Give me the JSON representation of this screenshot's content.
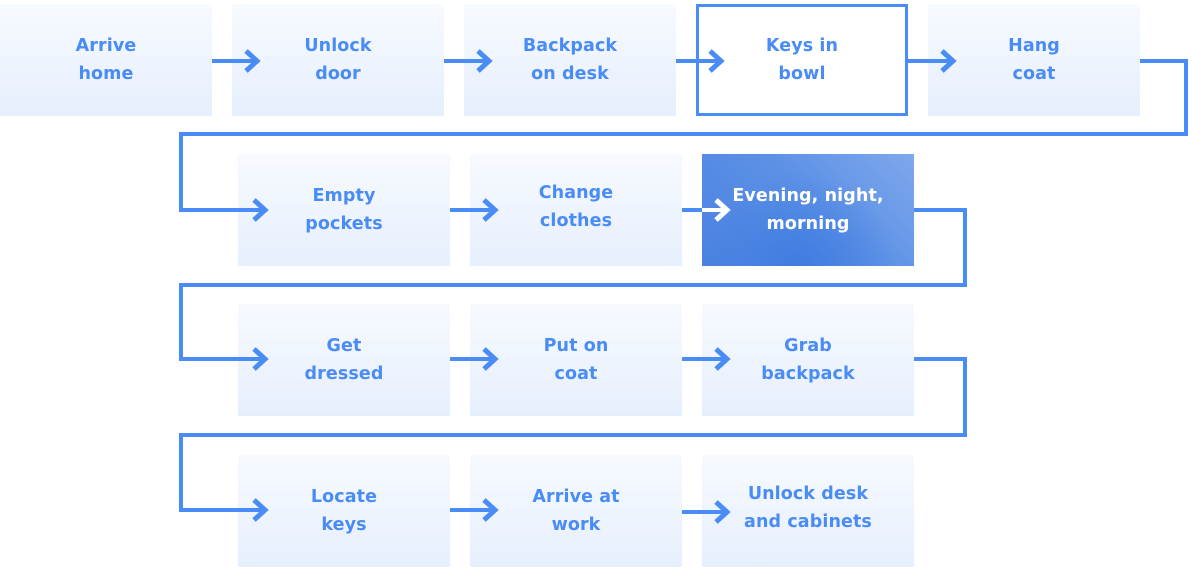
{
  "diagram": {
    "type": "process-flow",
    "colors": {
      "accent": "#4a8cf5",
      "box_fill_top": "#f7faff",
      "box_fill_bottom": "#e6effd",
      "highlight_fill": "#5d91e6",
      "highlight_text": "#ffffff"
    },
    "steps": [
      {
        "id": "arrive-home",
        "label": "Arrive\nhome",
        "style": "normal"
      },
      {
        "id": "unlock-door",
        "label": "Unlock\ndoor",
        "style": "normal"
      },
      {
        "id": "backpack-on-desk",
        "label": "Backpack\non desk",
        "style": "normal"
      },
      {
        "id": "keys-in-bowl",
        "label": "Keys in\nbowl",
        "style": "outlined"
      },
      {
        "id": "hang-coat",
        "label": "Hang\ncoat",
        "style": "normal"
      },
      {
        "id": "empty-pockets",
        "label": "Empty\npockets",
        "style": "normal"
      },
      {
        "id": "change-clothes",
        "label": "Change\nclothes",
        "style": "normal"
      },
      {
        "id": "evening-night-morning",
        "label": "Evening, night,\nmorning",
        "style": "highlighted"
      },
      {
        "id": "get-dressed",
        "label": "Get\ndressed",
        "style": "normal"
      },
      {
        "id": "put-on-coat",
        "label": "Put on\ncoat",
        "style": "normal"
      },
      {
        "id": "grab-backpack",
        "label": "Grab\nbackpack",
        "style": "normal"
      },
      {
        "id": "locate-keys",
        "label": "Locate\nkeys",
        "style": "normal"
      },
      {
        "id": "arrive-at-work",
        "label": "Arrive at\nwork",
        "style": "normal"
      },
      {
        "id": "unlock-desk-and-cabinets",
        "label": "Unlock desk\nand cabinets",
        "style": "normal"
      }
    ],
    "flow": [
      [
        "arrive-home",
        "unlock-door"
      ],
      [
        "unlock-door",
        "backpack-on-desk"
      ],
      [
        "backpack-on-desk",
        "keys-in-bowl"
      ],
      [
        "keys-in-bowl",
        "hang-coat"
      ],
      [
        "hang-coat",
        "empty-pockets"
      ],
      [
        "empty-pockets",
        "change-clothes"
      ],
      [
        "change-clothes",
        "evening-night-morning"
      ],
      [
        "evening-night-morning",
        "get-dressed"
      ],
      [
        "get-dressed",
        "put-on-coat"
      ],
      [
        "put-on-coat",
        "grab-backpack"
      ],
      [
        "grab-backpack",
        "locate-keys"
      ],
      [
        "locate-keys",
        "arrive-at-work"
      ],
      [
        "arrive-at-work",
        "unlock-desk-and-cabinets"
      ]
    ]
  }
}
